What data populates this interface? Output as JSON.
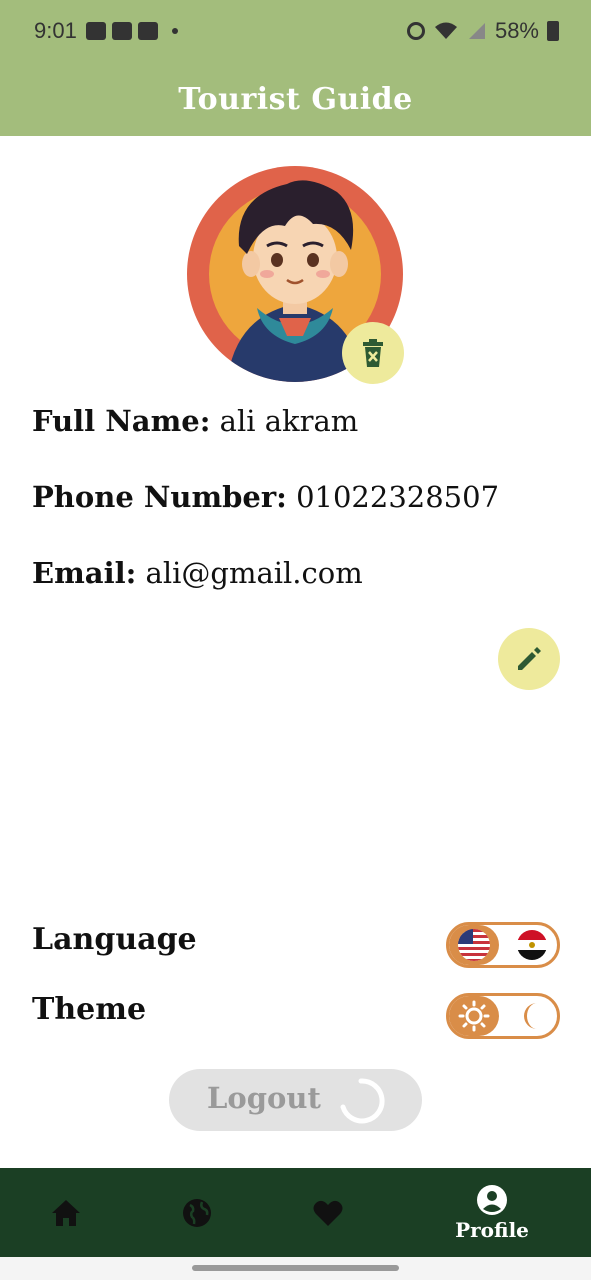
{
  "status_bar": {
    "time": "9:01",
    "battery": "58%"
  },
  "app_bar": {
    "title": "Tourist Guide"
  },
  "profile": {
    "full_name_label": "Full Name:",
    "full_name": "ali akram",
    "phone_label": "Phone Number:",
    "phone": "01022328507",
    "email_label": "Email:",
    "email": "ali@gmail.com"
  },
  "settings": {
    "language_label": "Language",
    "theme_label": "Theme"
  },
  "logout": {
    "label": "Logout"
  },
  "bottom_nav": {
    "items": [
      {
        "icon": "home-icon",
        "label": ""
      },
      {
        "icon": "globe-icon",
        "label": ""
      },
      {
        "icon": "heart-icon",
        "label": ""
      },
      {
        "icon": "account-circle-icon",
        "label": "Profile"
      }
    ],
    "selected": 3
  },
  "colors": {
    "app_bar": "#a3bd7c",
    "nav_bar": "#1b3f24",
    "fab": "#eeea9c",
    "toggle_accent": "#d98d48"
  }
}
